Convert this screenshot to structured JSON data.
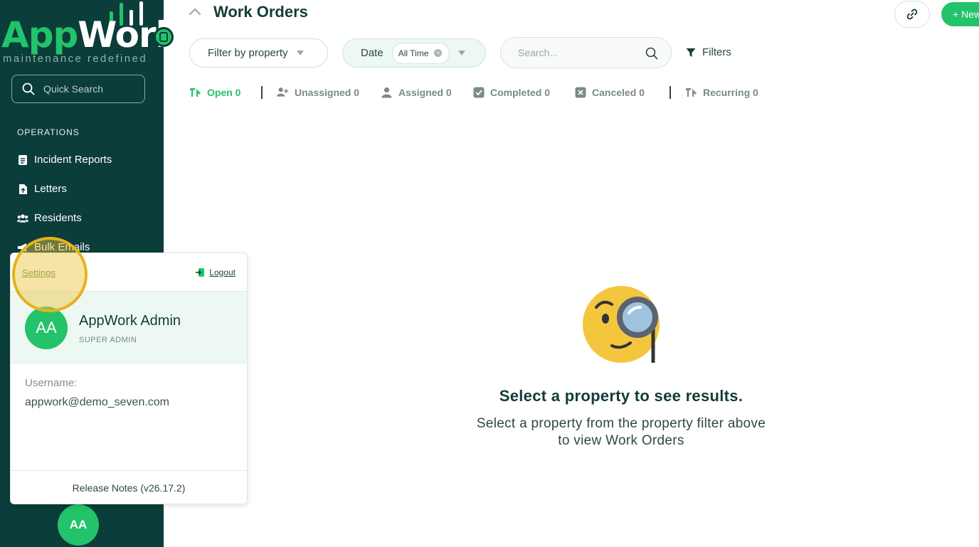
{
  "brand": {
    "name_part1": "App",
    "name_part2": "Work",
    "tagline": "maintenance redefined",
    "colors": {
      "sidebar": "#0b3d3a",
      "accent": "#22c36a",
      "highlight": "#e6b21c"
    }
  },
  "sidebar": {
    "quick_search_placeholder": "Quick Search",
    "section_title": "OPERATIONS",
    "items": [
      {
        "label": "Incident Reports",
        "icon": "document-icon"
      },
      {
        "label": "Letters",
        "icon": "file-upload-icon"
      },
      {
        "label": "Residents",
        "icon": "users-icon"
      },
      {
        "label": "Bulk Emails",
        "icon": "megaphone-icon"
      }
    ],
    "avatar_initials": "AA"
  },
  "popup": {
    "settings_label": "Settings",
    "logout_label": "Logout",
    "avatar_initials": "AA",
    "user_name": "AppWork Admin",
    "user_role": "SUPER ADMIN",
    "username_label": "Username:",
    "username_value": "appwork@demo_seven.com",
    "release_notes": "Release Notes (v26.17.2)"
  },
  "main": {
    "title": "Work Orders",
    "new_button": "+ New",
    "filter_property_label": "Filter by property",
    "date_label": "Date",
    "date_value": "All Time",
    "search_placeholder": "Search...",
    "filters_label": "Filters",
    "tabs": [
      {
        "label": "Open 0",
        "icon": "tools-icon",
        "active": true
      },
      {
        "label": "Unassigned 0",
        "icon": "user-plus-icon",
        "active": false
      },
      {
        "label": "Assigned 0",
        "icon": "user-icon",
        "active": false
      },
      {
        "label": "Completed 0",
        "icon": "check-square-icon",
        "active": false
      },
      {
        "label": "Canceled 0",
        "icon": "x-square-icon",
        "active": false
      },
      {
        "label": "Recurring 0",
        "icon": "recurring-tools-icon",
        "active": false
      }
    ],
    "empty_title": "Select a property to see results.",
    "empty_line1": "Select a property from the property filter above",
    "empty_line2": "to view Work Orders"
  }
}
